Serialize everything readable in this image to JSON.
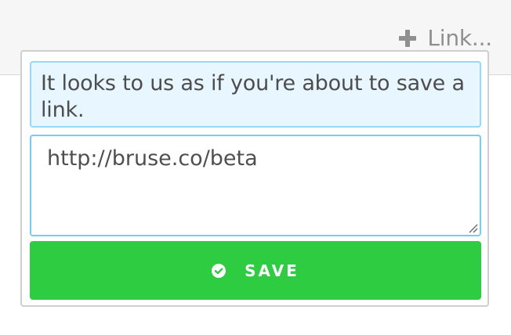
{
  "header": {
    "link_button": {
      "label": "Link...",
      "icon": "plus-icon"
    }
  },
  "popover": {
    "notice_text": "It looks to us as if you're about to save a link.",
    "url_input": {
      "value": "http://bruse.co/beta",
      "placeholder": ""
    },
    "save_button": {
      "label": "SAVE",
      "icon": "check-circle-icon"
    }
  },
  "colors": {
    "topbar_background": "#f6f6f6",
    "notice_background": "#e7f6ff",
    "notice_border": "#96d9f7",
    "input_border": "#73cdf4",
    "save_background": "#2ecc40",
    "muted_text": "#8f8f8f"
  }
}
